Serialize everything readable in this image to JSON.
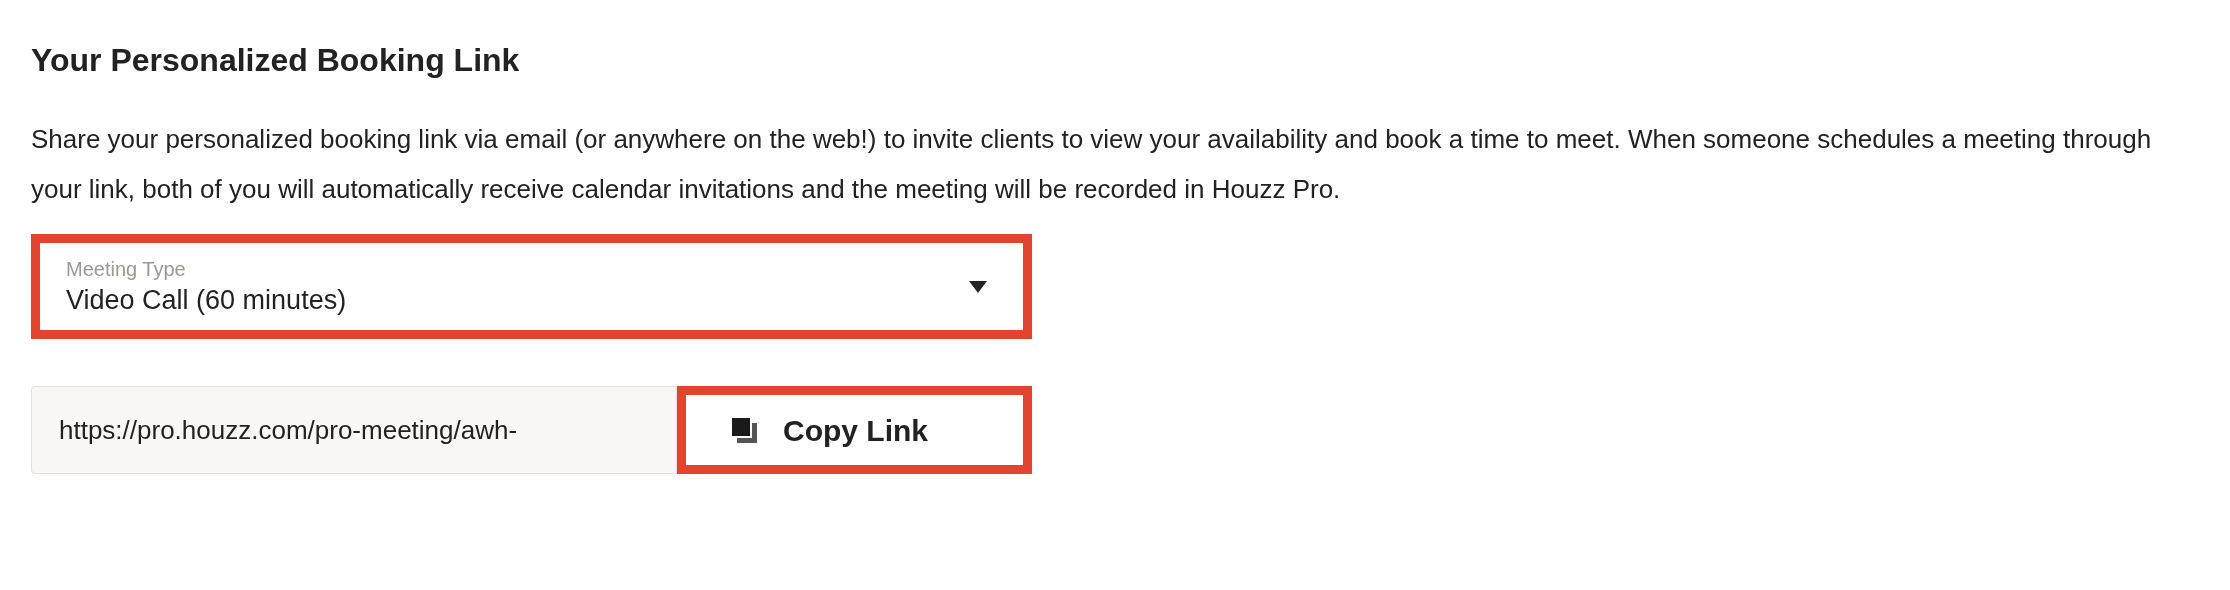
{
  "title": "Your Personalized Booking Link",
  "description": "Share your personalized booking link via email (or anywhere on the web!) to invite clients to view your availability and book a time to meet. When someone schedules a meeting through your link, both of you will automatically receive calendar invitations and the meeting will be recorded in Houzz Pro.",
  "meeting_type": {
    "label": "Meeting Type",
    "value": "Video Call (60 minutes)",
    "highlighted": true
  },
  "link_field": {
    "value": "https://pro.houzz.com/pro-meeting/awh-"
  },
  "copy_button": {
    "label": "Copy Link",
    "highlighted": true
  }
}
